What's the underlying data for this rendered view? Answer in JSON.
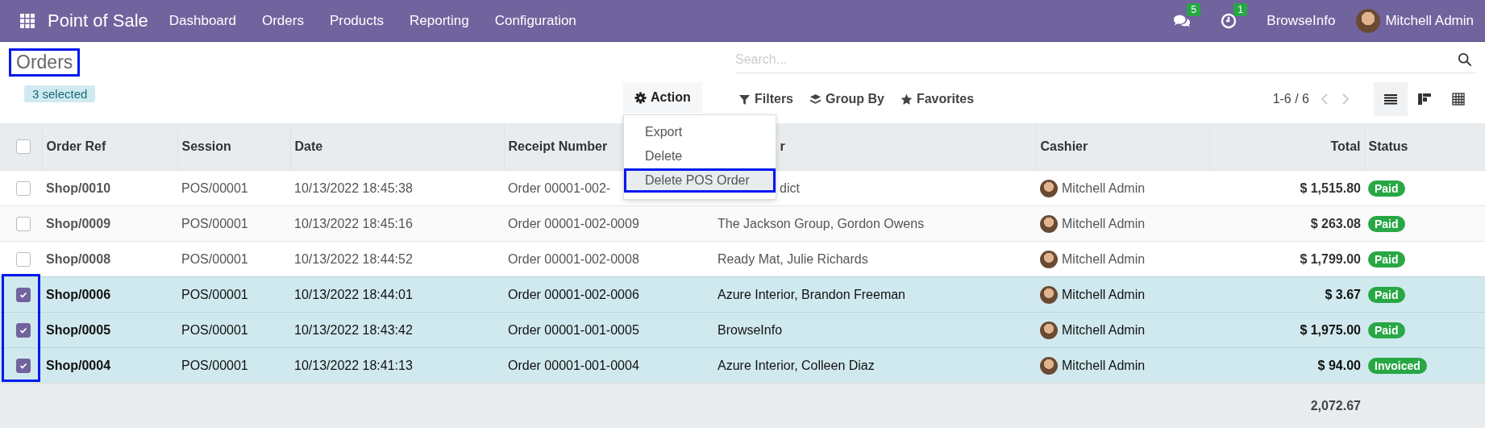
{
  "navbar": {
    "app_title": "Point of Sale",
    "menu": [
      "Dashboard",
      "Orders",
      "Products",
      "Reporting",
      "Configuration"
    ],
    "messages_count": "5",
    "activities_count": "1",
    "company": "BrowseInfo",
    "user": "Mitchell Admin"
  },
  "page": {
    "title": "Orders",
    "selection_badge": "3 selected",
    "action_button": "Action",
    "search": {
      "placeholder": "Search..."
    },
    "filters": [
      "Filters",
      "Group By",
      "Favorites"
    ],
    "pager": "1-6 / 6",
    "views": [
      {
        "kind": "list",
        "selected": true
      },
      {
        "kind": "kanban",
        "selected": false
      },
      {
        "kind": "pivot",
        "selected": false
      }
    ]
  },
  "action_menu": {
    "items": [
      {
        "label": "Export",
        "selected": false
      },
      {
        "label": "Delete",
        "selected": false
      },
      {
        "label": "Delete POS Order",
        "selected": true
      }
    ]
  },
  "table": {
    "header_checked": false,
    "columns": [
      "Order Ref",
      "Session",
      "Date",
      "Receipt Number",
      "r",
      "Cashier",
      "Total",
      "Status"
    ],
    "rows": [
      {
        "selected": false,
        "ref": "Shop/0010",
        "session": "POS/00001",
        "date": "10/13/2022 18:45:38",
        "receipt": "Order 00001-002-",
        "customer": "dict",
        "cashier": "Mitchell Admin",
        "total": "$ 1,515.80",
        "status": "Paid"
      },
      {
        "selected": false,
        "ref": "Shop/0009",
        "session": "POS/00001",
        "date": "10/13/2022 18:45:16",
        "receipt": "Order 00001-002-0009",
        "customer": "The Jackson Group, Gordon Owens",
        "cashier": "Mitchell Admin",
        "total": "$ 263.08",
        "status": "Paid"
      },
      {
        "selected": false,
        "ref": "Shop/0008",
        "session": "POS/00001",
        "date": "10/13/2022 18:44:52",
        "receipt": "Order 00001-002-0008",
        "customer": "Ready Mat, Julie Richards",
        "cashier": "Mitchell Admin",
        "total": "$ 1,799.00",
        "status": "Paid"
      },
      {
        "selected": true,
        "ref": "Shop/0006",
        "session": "POS/00001",
        "date": "10/13/2022 18:44:01",
        "receipt": "Order 00001-002-0006",
        "customer": "Azure Interior, Brandon Freeman",
        "cashier": "Mitchell Admin",
        "total": "$ 3.67",
        "status": "Paid"
      },
      {
        "selected": true,
        "ref": "Shop/0005",
        "session": "POS/00001",
        "date": "10/13/2022 18:43:42",
        "receipt": "Order 00001-001-0005",
        "customer": "BrowseInfo",
        "cashier": "Mitchell Admin",
        "total": "$ 1,975.00",
        "status": "Paid"
      },
      {
        "selected": true,
        "ref": "Shop/0004",
        "session": "POS/00001",
        "date": "10/13/2022 18:41:13",
        "receipt": "Order 00001-001-0004",
        "customer": "Azure Interior, Colleen Diaz",
        "cashier": "Mitchell Admin",
        "total": "$ 94.00",
        "status": "Invoiced"
      }
    ],
    "sum_total": "2,072.67"
  }
}
